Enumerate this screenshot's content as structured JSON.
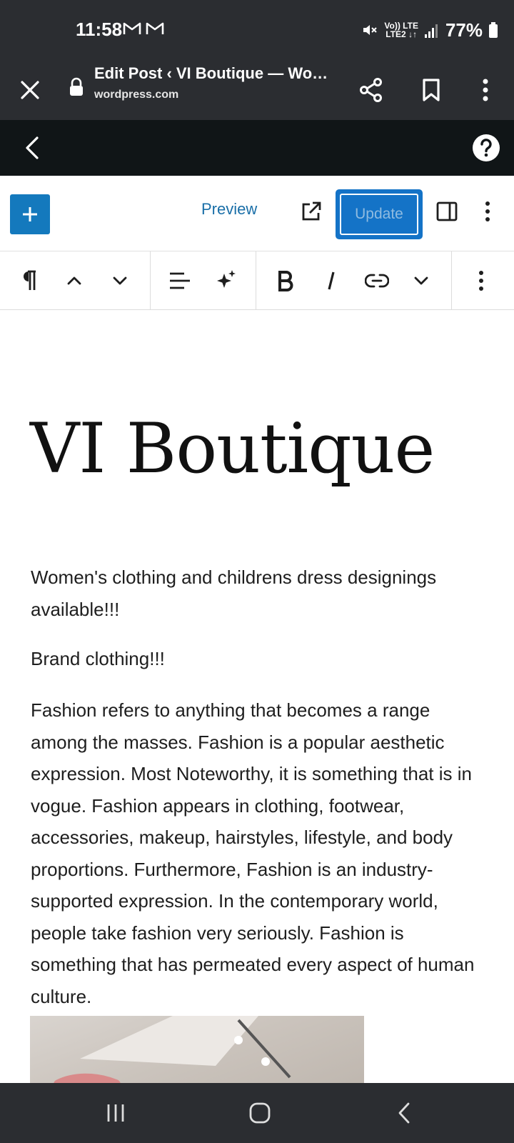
{
  "status": {
    "time": "11:58",
    "net_top": "Vo)) LTE",
    "net_bottom": "LTE2 ↓↑",
    "battery": "77%"
  },
  "browser": {
    "page_title": "Edit Post ‹ VI Boutique — Wo…",
    "url": "wordpress.com"
  },
  "editor": {
    "preview_label": "Preview",
    "update_label": "Update"
  },
  "post": {
    "title": "VI Boutique",
    "paragraphs": [
      "Women's clothing and childrens dress designings available!!!",
      "Brand clothing!!!",
      "Fashion refers to anything that becomes a range among the masses. Fashion is a popular aesthetic expression. Most Noteworthy, it is something that is in vogue. Fashion appears in clothing, footwear, accessories, makeup, hairstyles, lifestyle, and body proportions. Furthermore, Fashion is an industry-supported expression. In the contemporary world, people take fashion very seriously. Fashion is something that has permeated every aspect of human culture."
    ]
  },
  "colors": {
    "accent": "#1479bd",
    "chrome": "#2b2d31",
    "wp_bar": "#101517"
  }
}
